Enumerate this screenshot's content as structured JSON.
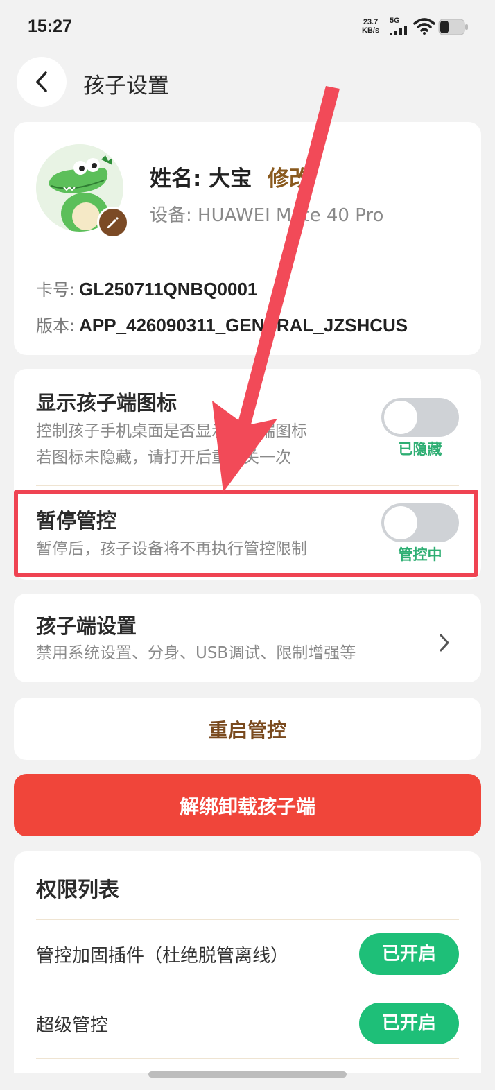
{
  "status_bar": {
    "time": "15:27",
    "net_speed_value": "23.7",
    "net_speed_unit": "KB/s",
    "network": "5G",
    "icons": [
      "signal-icon",
      "wifi-icon",
      "battery-icon"
    ]
  },
  "header": {
    "back_icon": "chevron-left-icon",
    "title": "孩子设置"
  },
  "profile": {
    "avatar": "crocodile-avatar",
    "edit_icon": "pencil-icon",
    "name": "姓名: 大宝",
    "modify_label": "修改",
    "device": "设备: HUAWEI Mate 40 Pro",
    "card_label": "卡号:",
    "card_value": "GL250711QNBQ0001",
    "version_label": "版本:",
    "version_value": "APP_426090311_GENERAL_JZSHCUS"
  },
  "settings": {
    "show_icon": {
      "title": "显示孩子端图标",
      "desc_line1": "控制孩子手机桌面是否显示孩子端图标",
      "desc_line2": "若图标未隐藏，请打开后重新关一次",
      "enabled": false,
      "status": "已隐藏"
    },
    "pause_control": {
      "title": "暂停管控",
      "desc": "暂停后，孩子设备将不再执行管控限制",
      "enabled": false,
      "status": "管控中"
    }
  },
  "child_settings": {
    "title": "孩子端设置",
    "desc": "禁用系统设置、分身、USB调试、限制增强等",
    "chevron_icon": "chevron-right-icon"
  },
  "restart_label": "重启管控",
  "unbind_label": "解绑卸载孩子端",
  "permissions": {
    "title": "权限列表",
    "items": [
      {
        "label": "管控加固插件（杜绝脱管离线）",
        "status": "已开启"
      },
      {
        "label": "超级管控",
        "status": "已开启"
      }
    ]
  },
  "colors": {
    "accent_brown": "#8a5a1e",
    "danger_red": "#f0453a",
    "success_green": "#1ebf78",
    "annotation_red": "#ef4352"
  }
}
